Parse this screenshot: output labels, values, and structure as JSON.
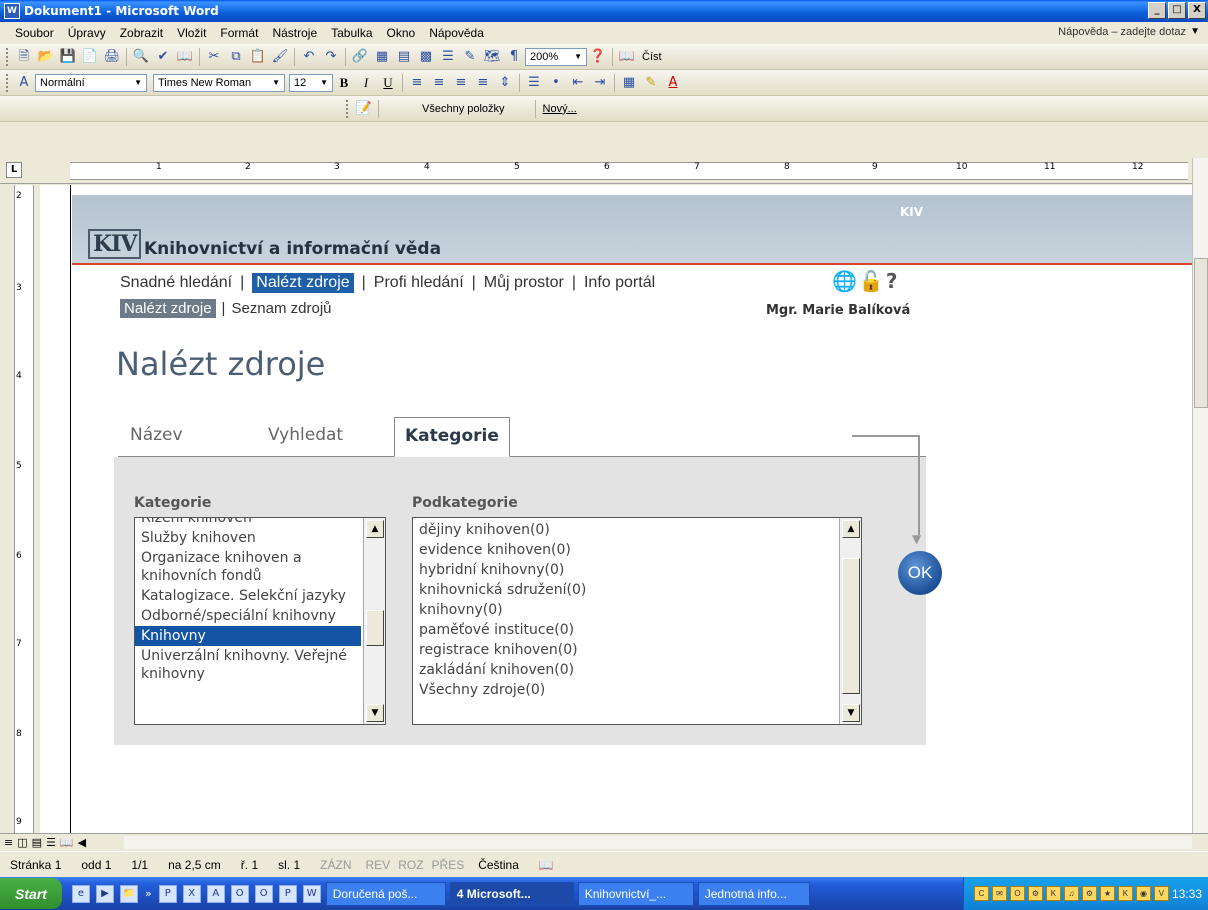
{
  "window": {
    "title": "Dokument1 - Microsoft Word",
    "app_icon": "W",
    "buttons": [
      "_",
      " ",
      "X"
    ]
  },
  "menubar": {
    "items": [
      "Soubor",
      "Úpravy",
      "Zobrazit",
      "Vložit",
      "Formát",
      "Nástroje",
      "Tabulka",
      "Okno",
      "Nápověda"
    ],
    "help_box": "Nápověda – zadejte dotaz"
  },
  "toolbar_standard": {
    "zoom": "200%",
    "read_label": "Číst"
  },
  "toolbar_format": {
    "style": "Normální",
    "font": "Times New Roman",
    "size": "12",
    "bold": "B",
    "italic": "I",
    "underline": "U"
  },
  "toolbar_review": {
    "all_items": "Všechny položky",
    "new": "Nový..."
  },
  "ruler": {
    "tab_btn": "L",
    "numbers": [
      "1",
      "2",
      "3",
      "4",
      "5",
      "6",
      "7",
      "8",
      "9",
      "10",
      "11",
      "12"
    ],
    "vnumbers": [
      "2",
      "3",
      "4",
      "5",
      "6",
      "7",
      "8",
      "9"
    ]
  },
  "web": {
    "logo": "KIV",
    "site_title": "Knihovnictví a informační věda",
    "kiv_label": "KIV",
    "nav": [
      "Snadné hledání",
      "Nalézt zdroje",
      "Profi hledání",
      "Můj prostor",
      "Info portál"
    ],
    "nav_active_index": 1,
    "subnav": [
      "Nalézt zdroje",
      "Seznam zdrojů"
    ],
    "user": "Mgr. Marie Balíková",
    "page_title": "Nalézt zdroje",
    "tabs": [
      "Název",
      "Vyhledat",
      "Kategorie"
    ],
    "active_tab": "Kategorie",
    "cat_label": "Kategorie",
    "sub_label": "Podkategorie",
    "categories": [
      "Řízení knihoven",
      "Služby knihoven",
      "Organizace knihoven a knihovních fondů",
      "Katalogizace. Selekční jazyky",
      "Odborné/speciální knihovny",
      "Knihovny",
      "Univerzální knihovny. Veřejné knihovny"
    ],
    "selected_category": "Knihovny",
    "subcategories": [
      "dějiny knihoven(0)",
      "evidence knihoven(0)",
      "hybridní knihovny(0)",
      "knihovnická sdružení(0)",
      "knihovny(0)",
      "paměťové instituce(0)",
      "registrace knihoven(0)",
      "zakládání knihoven(0)",
      "Všechny zdroje(0)"
    ],
    "ok": "OK"
  },
  "statusbar": {
    "page": "Stránka 1",
    "section": "odd 1",
    "pages": "1/1",
    "pos": "na 2,5 cm",
    "line": "ř. 1",
    "col": "sl. 1",
    "flags": [
      "ZÁZN",
      "REV",
      "ROZ",
      "PŘES"
    ],
    "lang": "Čeština"
  },
  "taskbar": {
    "start": "Start",
    "tasks": [
      "Doručená poš...",
      "4 Microsoft...",
      "Knihovnictví_...",
      "Jednotná info..."
    ],
    "active_task_index": 1,
    "clock": "13:33"
  },
  "colors": {
    "accent": "#1e5fa8",
    "banner_line": "#d9452b",
    "selection": "#1454a4"
  }
}
